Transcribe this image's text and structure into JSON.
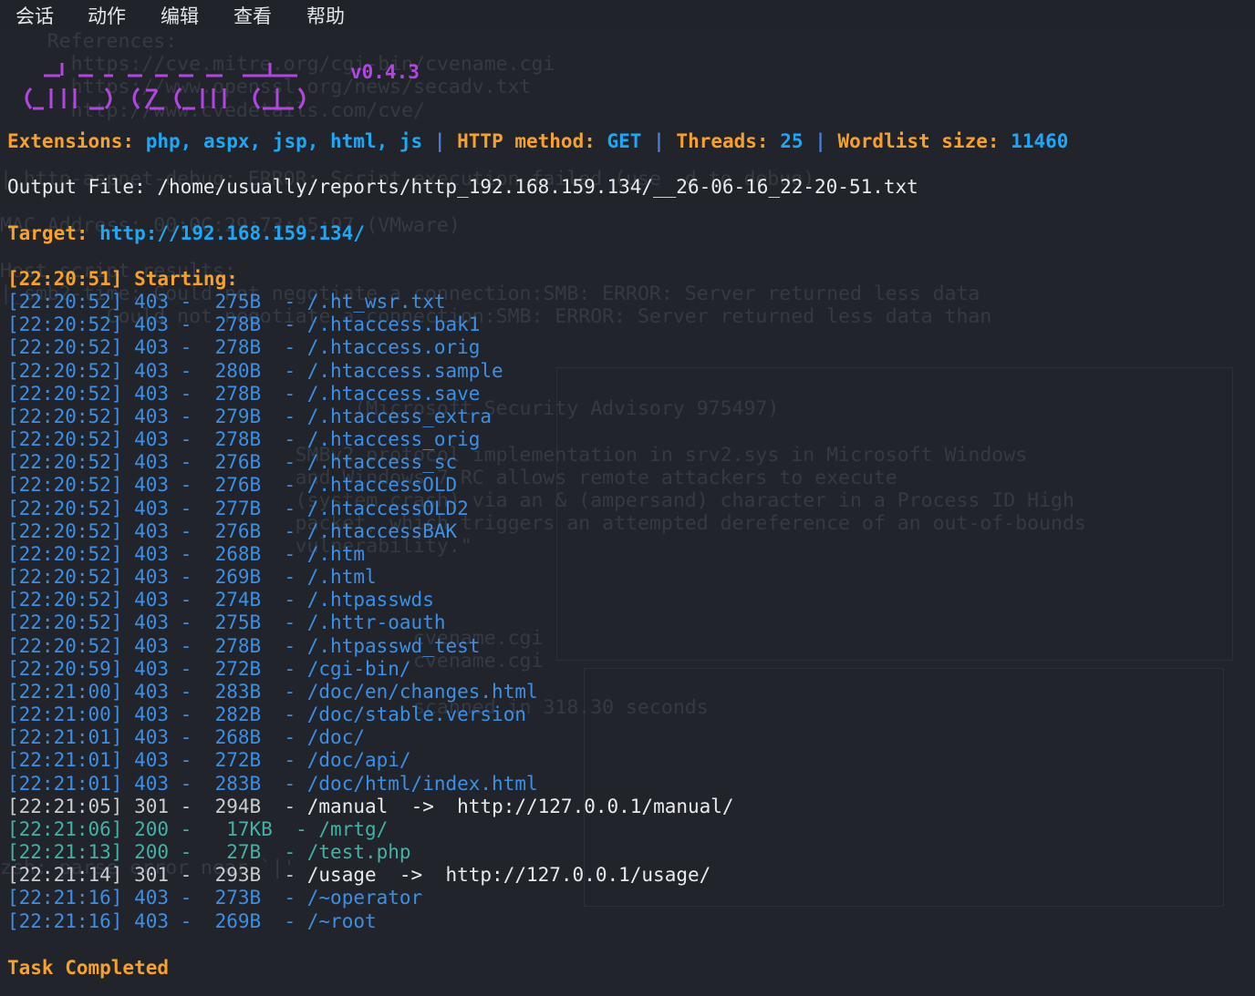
{
  "menu": [
    "会话",
    "动作",
    "编辑",
    "查看",
    "帮助"
  ],
  "version": "v0.4.3",
  "config": {
    "extensions_label": "Extensions:",
    "extensions_value": "php, aspx, jsp, html, js",
    "method_label": "HTTP method:",
    "method_value": "GET",
    "threads_label": "Threads:",
    "threads_value": "25",
    "wordlist_label": "Wordlist size:",
    "wordlist_value": "11460",
    "separator": "|"
  },
  "output_file": "Output File: /home/usually/reports/http_192.168.159.134/__26-06-16_22-20-51.txt",
  "target_label": "Target:",
  "target_url": "http://192.168.159.134/",
  "starting": "[22:20:51] Starting:",
  "results": [
    {
      "time": "[22:20:52]",
      "status": "403",
      "size": " 275B",
      "path": "/.ht_wsr.txt",
      "redirect": ""
    },
    {
      "time": "[22:20:52]",
      "status": "403",
      "size": " 278B",
      "path": "/.htaccess.bak1",
      "redirect": ""
    },
    {
      "time": "[22:20:52]",
      "status": "403",
      "size": " 278B",
      "path": "/.htaccess.orig",
      "redirect": ""
    },
    {
      "time": "[22:20:52]",
      "status": "403",
      "size": " 280B",
      "path": "/.htaccess.sample",
      "redirect": ""
    },
    {
      "time": "[22:20:52]",
      "status": "403",
      "size": " 278B",
      "path": "/.htaccess.save",
      "redirect": ""
    },
    {
      "time": "[22:20:52]",
      "status": "403",
      "size": " 279B",
      "path": "/.htaccess_extra",
      "redirect": ""
    },
    {
      "time": "[22:20:52]",
      "status": "403",
      "size": " 278B",
      "path": "/.htaccess_orig",
      "redirect": ""
    },
    {
      "time": "[22:20:52]",
      "status": "403",
      "size": " 276B",
      "path": "/.htaccess_sc",
      "redirect": ""
    },
    {
      "time": "[22:20:52]",
      "status": "403",
      "size": " 276B",
      "path": "/.htaccessOLD",
      "redirect": ""
    },
    {
      "time": "[22:20:52]",
      "status": "403",
      "size": " 277B",
      "path": "/.htaccessOLD2",
      "redirect": ""
    },
    {
      "time": "[22:20:52]",
      "status": "403",
      "size": " 276B",
      "path": "/.htaccessBAK",
      "redirect": ""
    },
    {
      "time": "[22:20:52]",
      "status": "403",
      "size": " 268B",
      "path": "/.htm",
      "redirect": ""
    },
    {
      "time": "[22:20:52]",
      "status": "403",
      "size": " 269B",
      "path": "/.html",
      "redirect": ""
    },
    {
      "time": "[22:20:52]",
      "status": "403",
      "size": " 274B",
      "path": "/.htpasswds",
      "redirect": ""
    },
    {
      "time": "[22:20:52]",
      "status": "403",
      "size": " 275B",
      "path": "/.httr-oauth",
      "redirect": ""
    },
    {
      "time": "[22:20:52]",
      "status": "403",
      "size": " 278B",
      "path": "/.htpasswd_test",
      "redirect": ""
    },
    {
      "time": "[22:20:59]",
      "status": "403",
      "size": " 272B",
      "path": "/cgi-bin/",
      "redirect": ""
    },
    {
      "time": "[22:21:00]",
      "status": "403",
      "size": " 283B",
      "path": "/doc/en/changes.html",
      "redirect": ""
    },
    {
      "time": "[22:21:00]",
      "status": "403",
      "size": " 282B",
      "path": "/doc/stable.version",
      "redirect": ""
    },
    {
      "time": "[22:21:01]",
      "status": "403",
      "size": " 268B",
      "path": "/doc/",
      "redirect": ""
    },
    {
      "time": "[22:21:01]",
      "status": "403",
      "size": " 272B",
      "path": "/doc/api/",
      "redirect": ""
    },
    {
      "time": "[22:21:01]",
      "status": "403",
      "size": " 283B",
      "path": "/doc/html/index.html",
      "redirect": ""
    },
    {
      "time": "[22:21:05]",
      "status": "301",
      "size": " 294B",
      "path": "/manual",
      "redirect": "  ->  http://127.0.0.1/manual/"
    },
    {
      "time": "[22:21:06]",
      "status": "200",
      "size": "  17KB",
      "path": "/mrtg/",
      "redirect": ""
    },
    {
      "time": "[22:21:13]",
      "status": "200",
      "size": "  27B",
      "path": "/test.php",
      "redirect": ""
    },
    {
      "time": "[22:21:14]",
      "status": "301",
      "size": " 293B",
      "path": "/usage",
      "redirect": "  ->  http://127.0.0.1/usage/"
    },
    {
      "time": "[22:21:16]",
      "status": "403",
      "size": " 273B",
      "path": "/~operator",
      "redirect": ""
    },
    {
      "time": "[22:21:16]",
      "status": "403",
      "size": " 269B",
      "path": "/~root",
      "redirect": ""
    }
  ],
  "completed": "Task Completed",
  "colors": {
    "background": "#21252b",
    "orange": "#f8a12a",
    "blue": "#1ea7f5",
    "path_blue": "#3c8fe6",
    "green": "#43b2a6",
    "purple": "#b345e2",
    "text": "#e9eaec"
  }
}
